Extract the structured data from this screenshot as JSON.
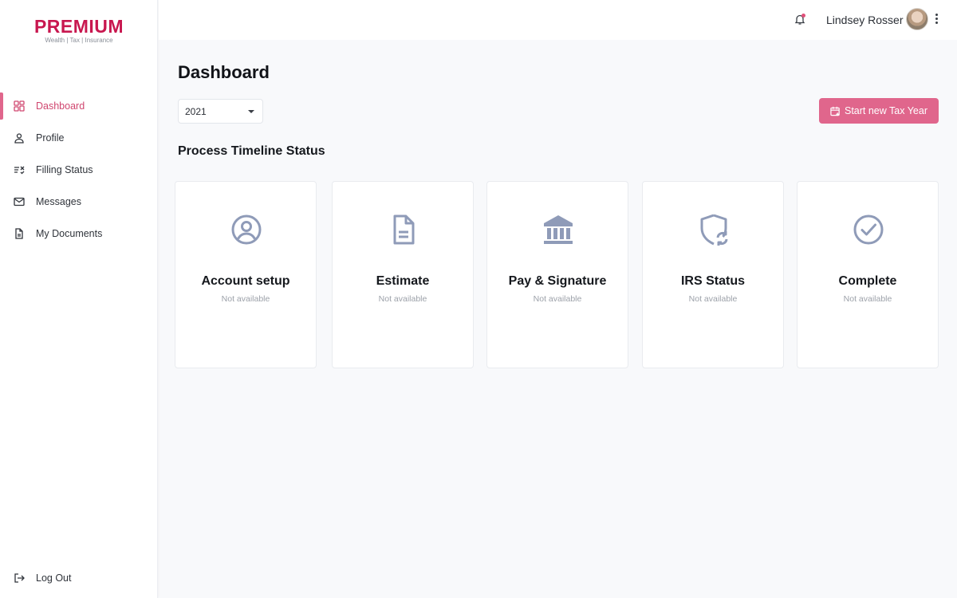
{
  "brand": {
    "name": "PREMIUM",
    "tagline": "Wealth | Tax | Insurance",
    "accent": "#e0668c",
    "logo_color": "#c8174f"
  },
  "sidebar": {
    "items": [
      {
        "label": "Dashboard",
        "icon": "dashboard-icon",
        "active": true
      },
      {
        "label": "Profile",
        "icon": "user-icon"
      },
      {
        "label": "Filling Status",
        "icon": "list-check-icon"
      },
      {
        "label": "Messages",
        "icon": "mail-icon"
      },
      {
        "label": "My Documents",
        "icon": "document-icon"
      }
    ],
    "logout": "Log Out"
  },
  "header": {
    "user_name": "Lindsey Rosser",
    "notification_icon": "bell-icon"
  },
  "main": {
    "title": "Dashboard",
    "year_select": "2021",
    "start_button": "Start new Tax Year",
    "section_title": "Process Timeline Status",
    "cards": [
      {
        "title": "Account setup",
        "status": "Not available",
        "icon": "user-circle-icon"
      },
      {
        "title": "Estimate",
        "status": "Not available",
        "icon": "file-icon"
      },
      {
        "title": "Pay & Signature",
        "status": "Not available",
        "icon": "bank-icon"
      },
      {
        "title": "IRS Status",
        "status": "Not available",
        "icon": "shield-refresh-icon"
      },
      {
        "title": "Complete",
        "status": "Not available",
        "icon": "check-circle-icon"
      }
    ]
  }
}
